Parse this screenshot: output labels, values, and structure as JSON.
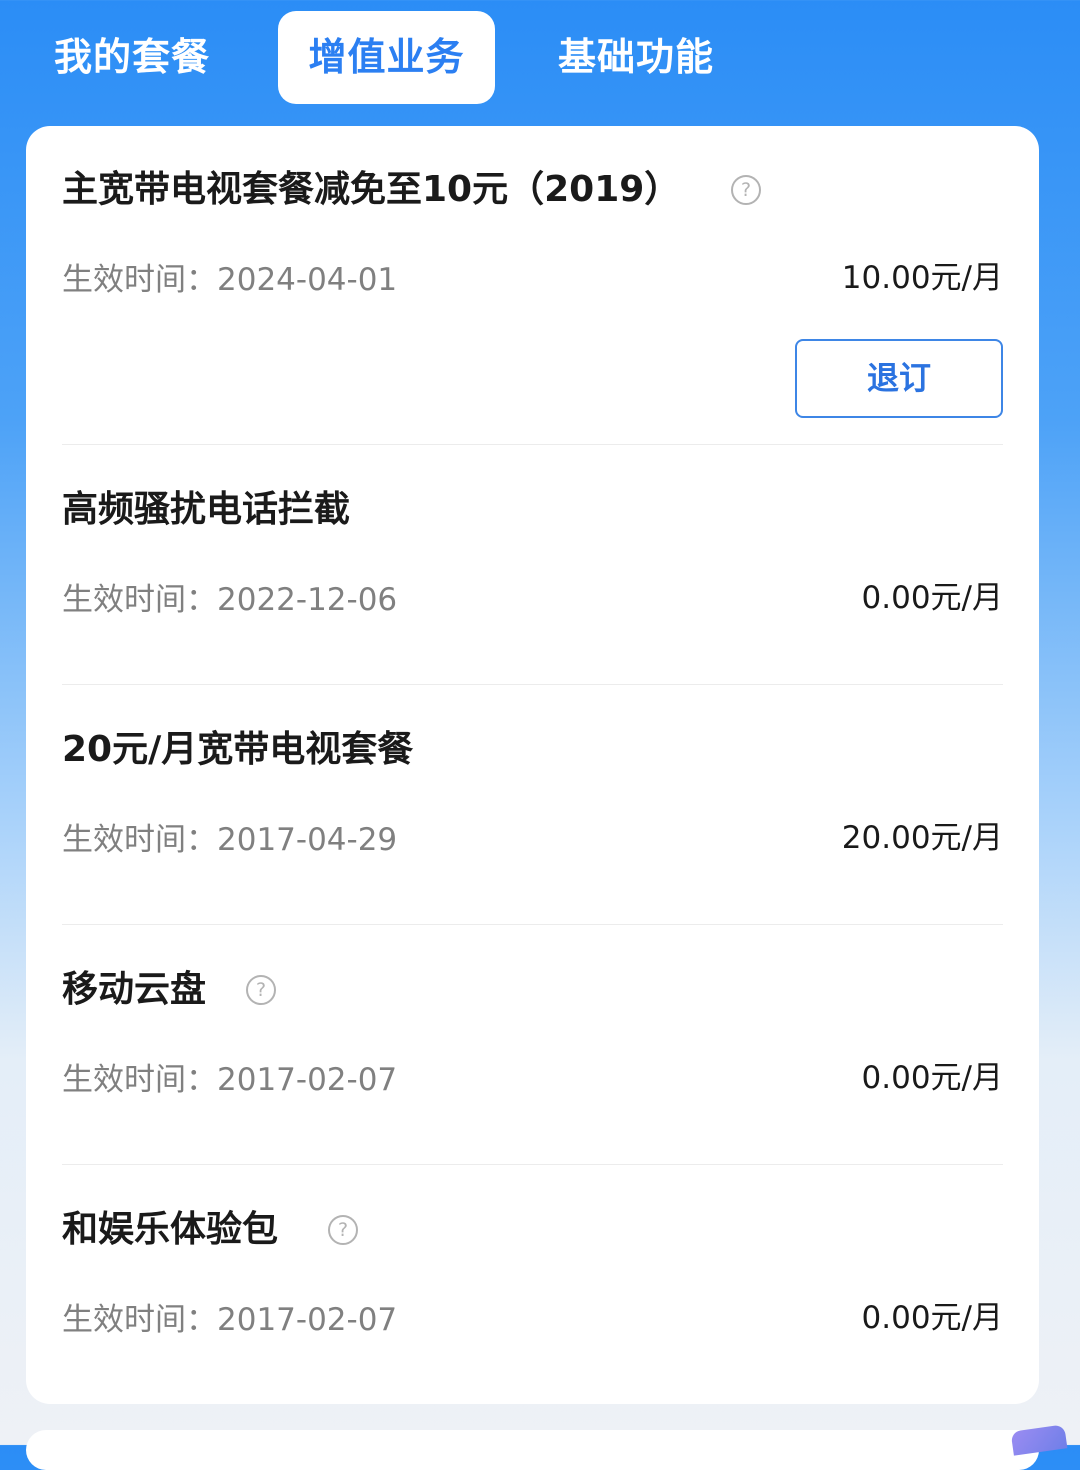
{
  "tabs": [
    {
      "label": "我的套餐",
      "active": false
    },
    {
      "label": "增值业务",
      "active": true
    },
    {
      "label": "基础功能",
      "active": false
    }
  ],
  "services": [
    {
      "name": "主宽带电视套餐减免至10元（2019）",
      "has_help": true,
      "date_label": "生效时间：2024-04-01",
      "price": "10.00元/月",
      "action": "退订"
    },
    {
      "name": "高频骚扰电话拦截",
      "has_help": false,
      "date_label": "生效时间：2022-12-06",
      "price": "0.00元/月"
    },
    {
      "name": "20元/月宽带电视套餐",
      "has_help": false,
      "date_label": "生效时间：2017-04-29",
      "price": "20.00元/月"
    },
    {
      "name": "移动云盘",
      "has_help": true,
      "date_label": "生效时间：2017-02-07",
      "price": "0.00元/月"
    },
    {
      "name": "和娱乐体验包",
      "has_help": true,
      "date_label": "生效时间：2017-02-07",
      "price": "0.00元/月"
    }
  ],
  "help_glyph": "?",
  "colors": {
    "header_blue": "#2B8DF6",
    "active_tab_text": "#2B7FF2",
    "button_border": "#3E86E6",
    "title_text": "#1A1A1A",
    "secondary_text": "#808080"
  }
}
